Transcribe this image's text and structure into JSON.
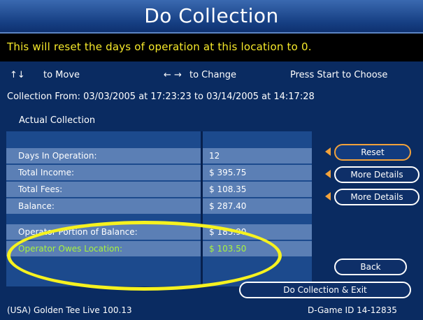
{
  "header": {
    "title": "Do Collection",
    "warning": "This will reset the days of operation at this location to 0."
  },
  "nav": {
    "move_arrows": "↑↓",
    "move_label": "to Move",
    "change_arrows": "← →",
    "change_label": "to Change",
    "choose_label": "Press Start to Choose"
  },
  "collection": {
    "from_text": "Collection From: 03/03/2005 at 17:23:23 to 03/14/2005 at 14:17:28",
    "section_title": "Actual Collection",
    "rows": [
      {
        "label": "Days In Operation:",
        "value": "12"
      },
      {
        "label": "Total Income:",
        "value": "$ 395.75"
      },
      {
        "label": "Total Fees:",
        "value": "$ 108.35"
      },
      {
        "label": "Balance:",
        "value": "$ 287.40"
      },
      {
        "label": "Operator Portion of Balance:",
        "value": "$ 183.90"
      },
      {
        "label": "Operator Owes Location:",
        "value": "$ 103.50"
      }
    ]
  },
  "buttons": {
    "reset": "Reset",
    "more_details_income": "More Details",
    "more_details_fees": "More Details",
    "back": "Back",
    "do_collection_exit": "Do Collection & Exit"
  },
  "footer": {
    "game_version": "(USA) Golden Tee Live 100.13",
    "game_id": "D-Game ID 14-12835"
  },
  "colors": {
    "warning_text": "#f6e92a",
    "highlight_text": "#a8f53c",
    "highlight_ellipse": "#f6f21f",
    "selection_accent": "#f2a23b"
  }
}
